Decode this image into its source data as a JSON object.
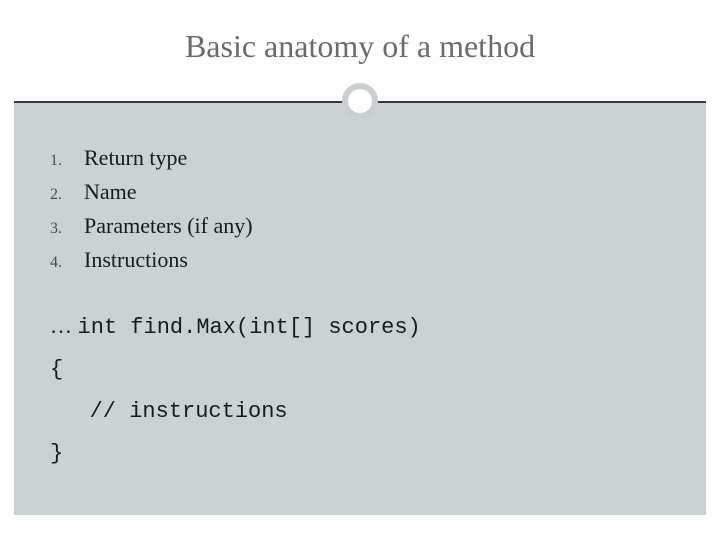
{
  "title": "Basic anatomy of a method",
  "list": [
    {
      "num": "1.",
      "text": "Return type"
    },
    {
      "num": "2.",
      "text": "Name"
    },
    {
      "num": "3.",
      "text": "Parameters (if any)"
    },
    {
      "num": "4.",
      "text": "Instructions"
    }
  ],
  "code": {
    "line1_prefix": "… ",
    "line1": "int find.Max(int[] scores)",
    "line2": "{",
    "line3": "   // instructions",
    "line4": "}"
  }
}
